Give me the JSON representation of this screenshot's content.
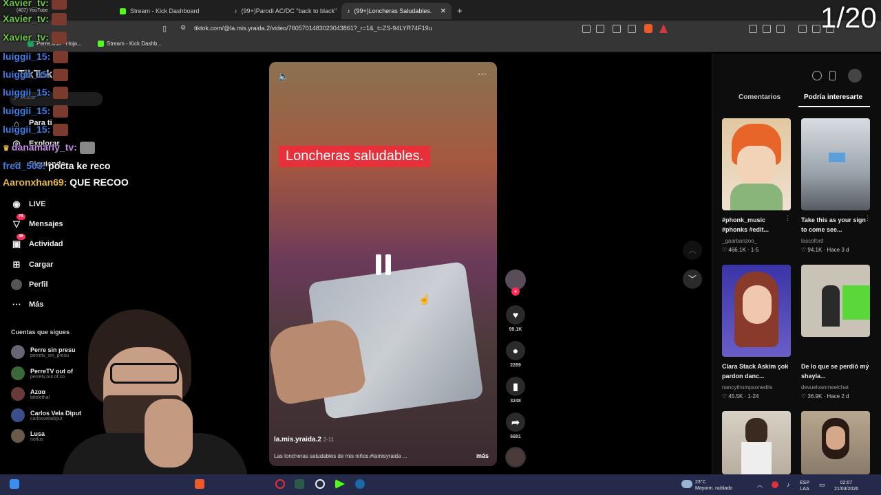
{
  "browser": {
    "tabs": [
      {
        "label": "Stream - Kick Dashboard",
        "icon": "kick-icon"
      },
      {
        "label": "(99+)Parodi AC/DC \"back to black\" #",
        "icon": "tiktok-icon"
      },
      {
        "label": "(99+)Loncheras Saludables.",
        "icon": "tiktok-icon"
      }
    ],
    "youtube_tab": "(407) YouTube",
    "url": "tiktok.com/@la.mis.yraida.2/video/7605701483023043861?_r=1&_t=ZS-94LYR74F19u",
    "bookmarks": [
      {
        "label": "Perre.xlsx - Hoja...",
        "icon": "sheets-icon"
      },
      {
        "label": "Stream - Kick Dashb...",
        "icon": "kick-icon"
      }
    ]
  },
  "page_counter": "1/20",
  "sidebar": {
    "logo": "TikTok",
    "search_placeholder": "Buscar",
    "items": [
      {
        "label": "Para ti",
        "icon": "home-icon"
      },
      {
        "label": "Explorar",
        "icon": "compass-icon"
      },
      {
        "label": "Siguiendo",
        "icon": "following-icon"
      },
      {
        "label": "LIVE",
        "icon": "live-icon"
      },
      {
        "label": "Mensajes",
        "icon": "message-icon",
        "badge": "78"
      },
      {
        "label": "Actividad",
        "icon": "activity-icon",
        "badge": "46"
      },
      {
        "label": "Cargar",
        "icon": "upload-icon"
      },
      {
        "label": "Perfil",
        "icon": "profile-icon"
      },
      {
        "label": "Más",
        "icon": "more-icon"
      }
    ],
    "following_title": "Cuentas que sigues",
    "following": [
      {
        "name": "Perre sin presu",
        "handle": "perretv_sin_presu"
      },
      {
        "name": "PerreTV out of",
        "handle": "perretv.out.of.co"
      },
      {
        "name": "Azαα",
        "handle": "bitelethal"
      },
      {
        "name": "Carlos Vela Diput",
        "handle": "carlosveladiput"
      },
      {
        "name": "Lusa",
        "handle": "notlus"
      }
    ]
  },
  "chat": [
    {
      "user": "Xavier_tv:",
      "color": "#6cc24a"
    },
    {
      "user": "Xavier_tv:",
      "color": "#6cc24a"
    },
    {
      "user": "Xavier_tv:",
      "color": "#6cc24a"
    },
    {
      "user": "luiggii_15:",
      "color": "#3d7ee8"
    },
    {
      "user": "luiggii_15:",
      "color": "#3d7ee8"
    },
    {
      "user": "luiggii_15:",
      "color": "#3d7ee8"
    },
    {
      "user": "luiggii_15:",
      "color": "#3d7ee8"
    },
    {
      "user": "luiggii_15:",
      "color": "#3d7ee8"
    },
    {
      "user": "danamarly_tv:",
      "color": "#c48be6",
      "text": ""
    },
    {
      "user": "fred_503:",
      "color": "#3d7ee8",
      "text": "pocta ke reco"
    },
    {
      "user": "Aaronxhan69:",
      "color": "#e6b84c",
      "text": "QUE RECOO"
    }
  ],
  "video": {
    "overlay_text": "Loncheras saludables.",
    "author": "la.mis.yraida.2",
    "date": "2-11",
    "caption": "Las loncheras saludables de mis niños.#lamisyraida ...",
    "more": "más"
  },
  "actions": [
    {
      "icon": "heart-icon",
      "count": "99.1K"
    },
    {
      "icon": "comment-icon",
      "count": "2269"
    },
    {
      "icon": "bookmark-icon",
      "count": "3248"
    },
    {
      "icon": "share-icon",
      "count": "6881"
    }
  ],
  "right_panel": {
    "tabs": [
      "Comentarios",
      "Podría interesarte"
    ],
    "items": [
      {
        "title": "#phonk_music #phonks #edit...",
        "user": "_gaarbanzoo_",
        "stats": "466.1K · 1-5"
      },
      {
        "title": "Take this as your sign to come see...",
        "user": "lascoford",
        "stats": "94.1K · Hace 3 d"
      },
      {
        "title": "Clara Stack Askim çok pardon danc...",
        "user": "nancythompsonedits",
        "stats": "45.5K · 1-24"
      },
      {
        "title": "De lo que se perdió my shayla...",
        "user": "devuelvanmeelchat",
        "stats": "36.9K · Hace 2 d"
      }
    ]
  },
  "taskbar": {
    "weather": "23°C",
    "weather_desc": "Mayorm. nublado",
    "lang": "ESP",
    "lang2": "LAA",
    "time": "02:07",
    "date": "21/03/2026"
  }
}
